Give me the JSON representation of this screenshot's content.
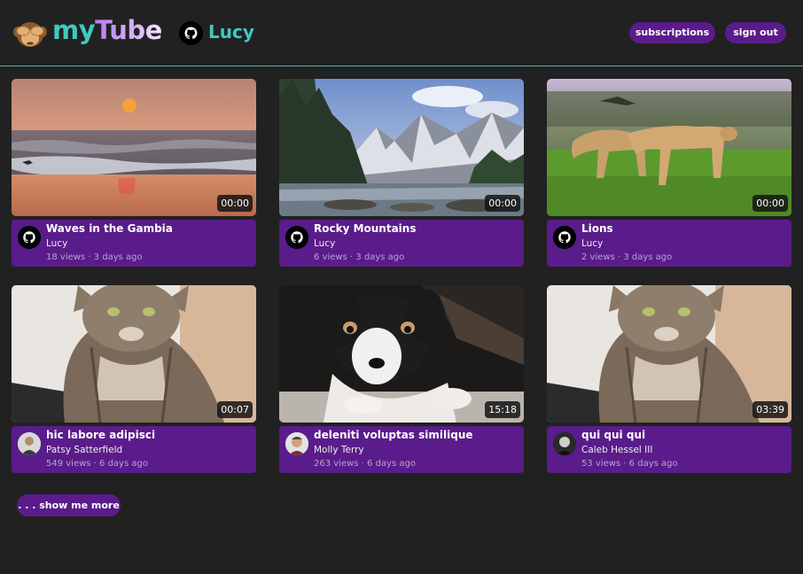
{
  "header": {
    "logo_my": "my",
    "logo_tube": "Tube",
    "user_name": "Lucy",
    "subscriptions_label": "subscriptions",
    "signout_label": "sign out"
  },
  "videos": [
    {
      "title": "Waves in the Gambia",
      "channel": "Lucy",
      "meta": "18 views · 3 days ago",
      "duration": "00:00",
      "avatar": "github-icon",
      "thumb": "sunset-beach"
    },
    {
      "title": "Rocky Mountains",
      "channel": "Lucy",
      "meta": "6 views · 3 days ago",
      "duration": "00:00",
      "avatar": "github-icon",
      "thumb": "mountain-lake"
    },
    {
      "title": "Lions",
      "channel": "Lucy",
      "meta": "2 views · 3 days ago",
      "duration": "00:00",
      "avatar": "github-icon",
      "thumb": "lionesses-grass"
    },
    {
      "title": "hic labore adipisci",
      "channel": "Patsy Satterfield",
      "meta": "549 views · 6 days ago",
      "duration": "00:07",
      "avatar": "person-avatar",
      "thumb": "tabby-cat"
    },
    {
      "title": "deleniti voluptas similique",
      "channel": "Molly Terry",
      "meta": "263 views · 6 days ago",
      "duration": "15:18",
      "avatar": "person-avatar",
      "thumb": "puppy"
    },
    {
      "title": "qui qui qui",
      "channel": "Caleb Hessel III",
      "meta": "53 views · 6 days ago",
      "duration": "03:39",
      "avatar": "person-avatar",
      "thumb": "tabby-cat"
    }
  ],
  "show_more_label": ". . . show me more",
  "colors": {
    "accent": "#5a1c8a",
    "teal": "#3fc9c0",
    "background": "#212121"
  }
}
